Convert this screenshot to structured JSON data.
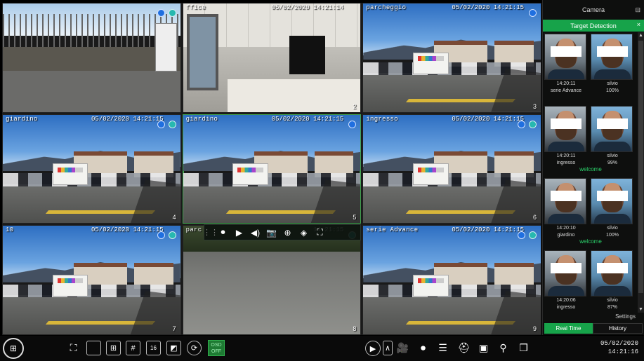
{
  "grid": {
    "tiles": [
      {
        "name": "",
        "time": "",
        "ch": "",
        "scene": "street",
        "dots": "both"
      },
      {
        "name": "ffice",
        "time": "05/02/2020 14:21:14",
        "ch": "2",
        "scene": "office",
        "dots": "none"
      },
      {
        "name": "parcheggio",
        "time": "05/02/2020 14:21:15",
        "ch": "3",
        "scene": "parking",
        "dots": "blue"
      },
      {
        "name": "giardino",
        "time": "05/02/2020 14:21:15",
        "ch": "4",
        "scene": "parking",
        "dots": "both"
      },
      {
        "name": "giardino",
        "time": "05/02/2020 14:21:15",
        "ch": "5",
        "scene": "parking",
        "dots": "blue",
        "selected": true
      },
      {
        "name": "ingresso",
        "time": "05/02/2020 14:21:15",
        "ch": "6",
        "scene": "parking",
        "dots": "both"
      },
      {
        "name": "10",
        "time": "05/02/2020 14:21:15",
        "ch": "7",
        "scene": "parking",
        "dots": "both"
      },
      {
        "name": "parc",
        "time": "14:21:15",
        "ch": "8",
        "scene": "asphalt",
        "dots": "teal"
      },
      {
        "name": "serie Advance",
        "time": "05/02/2020 14:21:15",
        "ch": "9",
        "scene": "parking",
        "dots": "both"
      }
    ]
  },
  "float_toolbar": {
    "icons": [
      "record-icon",
      "play-icon",
      "audio-icon",
      "snapshot-icon",
      "zoom-icon",
      "3d-icon",
      "fullscreen-icon"
    ],
    "glyphs": [
      "⏺",
      "▶",
      "◀)",
      "📷",
      "⊕",
      "◈",
      "⛶"
    ]
  },
  "panel": {
    "title": "Camera",
    "target_tab": "Target Detection",
    "groups": [
      {
        "left": {
          "time": "14:20:11",
          "label": "serie Advance"
        },
        "right": {
          "name": "silvio",
          "score": "100%"
        },
        "welcome": ""
      },
      {
        "left": {
          "time": "14:20:11",
          "label": "ingresso"
        },
        "right": {
          "name": "silvio",
          "score": "99%"
        },
        "welcome": "welcome"
      },
      {
        "left": {
          "time": "14:20:10",
          "label": "giardino"
        },
        "right": {
          "name": "silvio",
          "score": "100%"
        },
        "welcome": "welcome"
      },
      {
        "left": {
          "time": "14:20:06",
          "label": "ingresso"
        },
        "right": {
          "name": "silvio",
          "score": "87%"
        },
        "welcome": ""
      }
    ],
    "settings": "Settings",
    "tab_realtime": "Real Time",
    "tab_history": "History"
  },
  "toolbar": {
    "osd_line1": "OSD",
    "osd_line2": "OFF",
    "clock_date": "05/02/2020",
    "clock_time": "14:21:16"
  }
}
